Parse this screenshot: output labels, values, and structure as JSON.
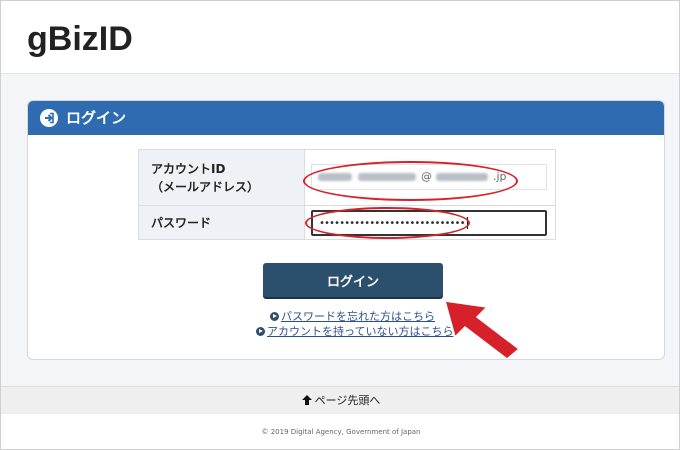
{
  "header": {
    "logo": "gBizID"
  },
  "login_card": {
    "title": "ログイン",
    "fields": {
      "account_label_line1": "アカウントID",
      "account_label_line2": "（メールアドレス）",
      "account_value": "@",
      "account_value_suffix": ".jp",
      "password_label": "パスワード",
      "password_value": "•••••••••••••••••••••••••••••"
    },
    "login_button": "ログイン",
    "links": {
      "forgot_password": "パスワードを忘れた方はこちら",
      "no_account": "アカウントを持っていない方はこちら"
    }
  },
  "footer": {
    "back_to_top": "ページ先頭へ",
    "copyright": "© 2019 Digital Agency, Government of Japan"
  },
  "colors": {
    "card_header": "#2f6bb0",
    "button": "#2b4f6d",
    "annotation_red": "#d6212a"
  }
}
